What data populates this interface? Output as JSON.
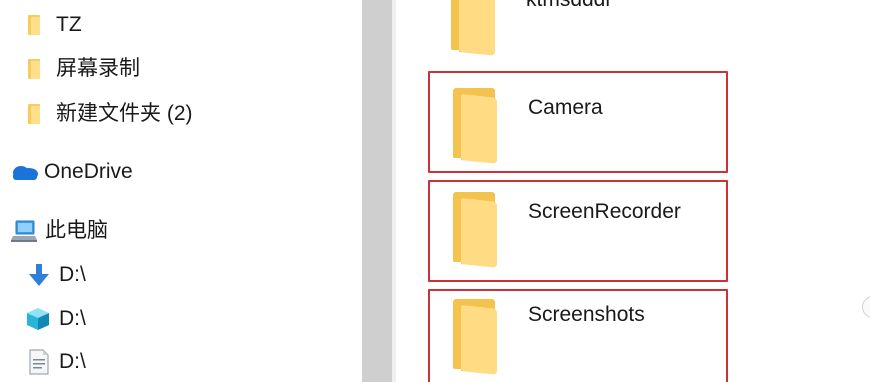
{
  "nav": {
    "items": [
      {
        "label": "TZ",
        "icon": "folder-icon"
      },
      {
        "label": "屏幕录制",
        "icon": "folder-icon"
      },
      {
        "label": "新建文件夹 (2)",
        "icon": "folder-icon"
      },
      {
        "label": "OneDrive",
        "icon": "onedrive-cloud-icon"
      },
      {
        "label": "此电脑",
        "icon": "this-pc-icon"
      },
      {
        "label": "D:\\",
        "icon": "download-arrow-icon"
      },
      {
        "label": "D:\\",
        "icon": "3d-objects-icon"
      },
      {
        "label": "D:\\",
        "icon": "document-icon"
      }
    ]
  },
  "content": {
    "folders": [
      {
        "name": "ktmsdddl",
        "highlighted": false
      },
      {
        "name": "Camera",
        "highlighted": true
      },
      {
        "name": "ScreenRecorder",
        "highlighted": true
      },
      {
        "name": "Screenshots",
        "highlighted": true
      }
    ]
  },
  "colors": {
    "highlight_border": "#c8333a",
    "folder_back": "#f3c24f",
    "folder_front": "#ffdc84",
    "onedrive_blue": "#1a73d9",
    "scrollbar": "#cfcfcf"
  }
}
